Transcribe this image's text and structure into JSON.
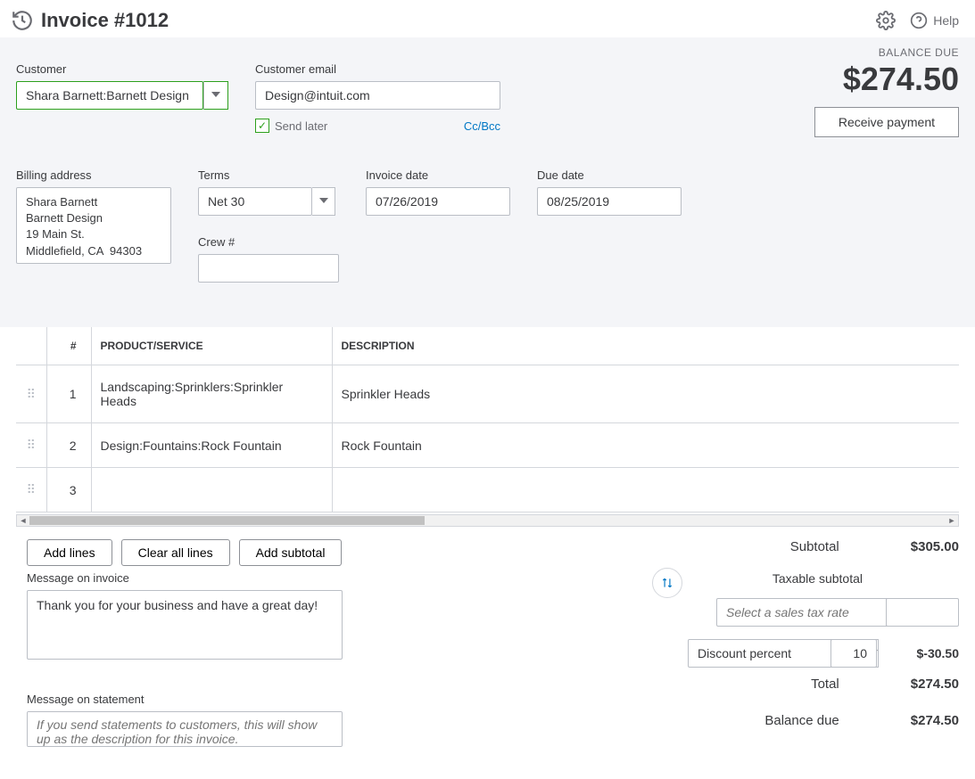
{
  "header": {
    "title": "Invoice #1012",
    "help_label": "Help"
  },
  "customer": {
    "label": "Customer",
    "value": "Shara Barnett:Barnett Design"
  },
  "email": {
    "label": "Customer email",
    "value": "Design@intuit.com",
    "send_later": "Send later",
    "cc_bcc": "Cc/Bcc"
  },
  "balance": {
    "label": "BALANCE DUE",
    "amount": "$274.50",
    "receive_btn": "Receive payment"
  },
  "billing": {
    "label": "Billing address",
    "value": "Shara Barnett\nBarnett Design\n19 Main St.\nMiddlefield, CA  94303"
  },
  "terms": {
    "label": "Terms",
    "value": "Net 30"
  },
  "invoice_date": {
    "label": "Invoice date",
    "value": "07/26/2019"
  },
  "due_date": {
    "label": "Due date",
    "value": "08/25/2019"
  },
  "crew": {
    "label": "Crew #",
    "value": ""
  },
  "table": {
    "col_num": "#",
    "col_product": "PRODUCT/SERVICE",
    "col_description": "DESCRIPTION",
    "rows": [
      {
        "n": "1",
        "product": "Landscaping:Sprinklers:Sprinkler Heads",
        "desc": "Sprinkler Heads"
      },
      {
        "n": "2",
        "product": "Design:Fountains:Rock Fountain",
        "desc": "Rock Fountain"
      },
      {
        "n": "3",
        "product": "",
        "desc": ""
      }
    ]
  },
  "buttons": {
    "add_lines": "Add lines",
    "clear_lines": "Clear all lines",
    "add_subtotal": "Add subtotal"
  },
  "totals": {
    "subtotal_label": "Subtotal",
    "subtotal_value": "$305.00",
    "taxable_label": "Taxable subtotal",
    "tax_placeholder": "Select a sales tax rate",
    "tax_value": "",
    "discount_label": "Discount percent",
    "discount_value": "10",
    "discount_amount": "$-30.50",
    "total_label": "Total",
    "total_value": "$274.50",
    "balance_due_label": "Balance due",
    "balance_due_value": "$274.50"
  },
  "messages": {
    "invoice_label": "Message on invoice",
    "invoice_value": "Thank you for your business and have a great day!",
    "statement_label": "Message on statement",
    "statement_placeholder": "If you send statements to customers, this will show up as the description for this invoice."
  }
}
